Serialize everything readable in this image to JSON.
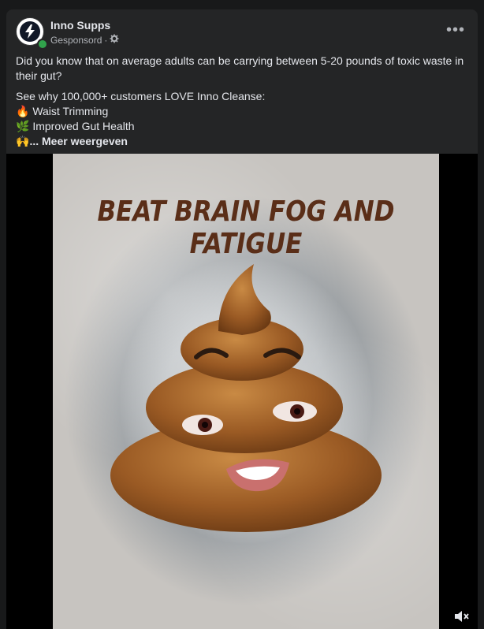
{
  "post": {
    "page_name": "Inno Supps",
    "sponsored_label": "Gesponsord",
    "separator": " · ",
    "body": {
      "line1": "Did you know that on average adults can be carrying between 5-20 pounds of toxic waste in their gut?",
      "line2": "See why 100,000+ customers LOVE Inno Cleanse:",
      "bullet1_emoji": "🔥",
      "bullet1_text": "Waist Trimming",
      "bullet2_emoji": "🌿",
      "bullet2_text": "Improved Gut Health",
      "bullet3_emoji": "🙌",
      "see_more": "... Meer weergeven"
    },
    "more_icon_label": "•••"
  },
  "video": {
    "headline": "BEAT BRAIN FOG AND FATIGUE"
  },
  "colors": {
    "background": "#18191a",
    "card": "#242526",
    "text": "#e4e6eb",
    "secondary_text": "#b0b3b8",
    "online": "#31a24c",
    "headline": "#5a2e18"
  },
  "icons": {
    "avatar": "lightning-bolt-logo-icon",
    "privacy": "gear-icon",
    "more": "more-options-icon",
    "mute": "speaker-muted-icon"
  }
}
